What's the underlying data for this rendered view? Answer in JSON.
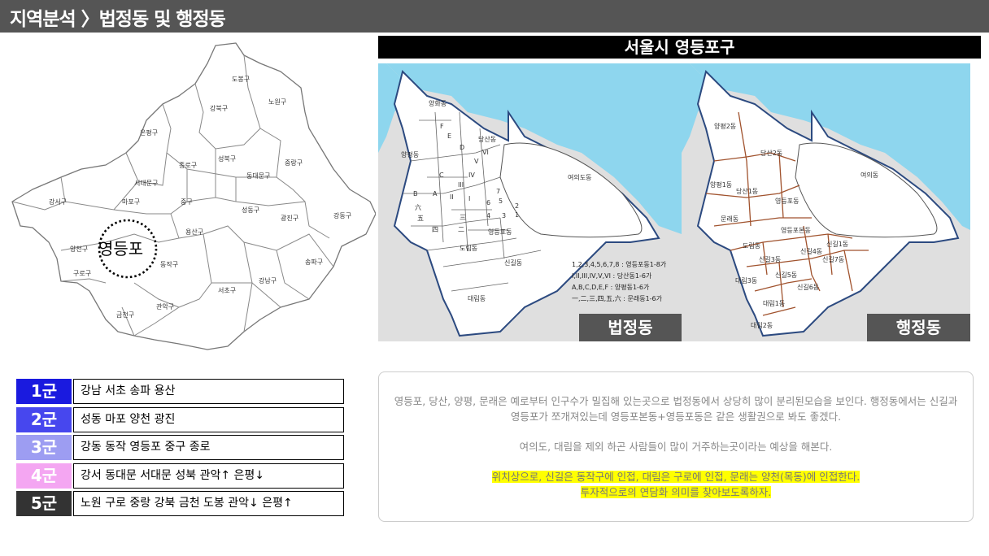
{
  "header": {
    "title": "지역분석 〉법정동 및 행정동"
  },
  "right_title": "서울시 영등포구",
  "seoul_map": {
    "districts": {
      "dobong": "도봉구",
      "nowon": "노원구",
      "gangbuk": "강북구",
      "eunpyeong": "은평구",
      "seongbuk": "성북구",
      "jungnang": "중랑구",
      "jongno": "종로구",
      "seodaemun": "서대문구",
      "dongdaemun": "동대문구",
      "gangseo": "강서구",
      "mapo": "마포구",
      "jung": "중구",
      "seongdong": "성동구",
      "gwangjin": "광진구",
      "gangdong": "강동구",
      "yongsan": "용산구",
      "yangcheon": "양천구",
      "guro": "구로구",
      "dongjak": "동작구",
      "songpa": "송파구",
      "gangnam": "강남구",
      "seocho": "서초구",
      "gwanak": "관악구",
      "geumcheon": "금천구"
    },
    "highlight": "영등포"
  },
  "legal_map": {
    "badge": "법정동",
    "dongs": {
      "yanghwa": "양화동",
      "dangsan": "당산동",
      "yangpyeong": "양평동",
      "yeouido": "여의도동",
      "yeongdeungpo": "영등포동",
      "dorim": "도림동",
      "singil": "신길동",
      "daerim": "대림동"
    },
    "letters": {
      "f": "F",
      "e": "E",
      "d": "D",
      "c": "C",
      "b": "B",
      "a": "A",
      "r6": "VI",
      "r5": "V",
      "r4": "IV",
      "r3": "III",
      "r2": "II",
      "r1": "I",
      "n6": "6",
      "n5": "5",
      "n2": "2",
      "n7": "7",
      "n4": "4",
      "n3": "3",
      "n1": "1",
      "h6": "六",
      "h5": "五",
      "h4": "四",
      "h3": "三",
      "h2": "二"
    },
    "legend": [
      "1,2,3,4,5,6,7,8 : 영등포동1-8가",
      "I,II,III,IV,V,VI : 당산동1-6가",
      "A,B,C,D,E,F : 양평동1-6가",
      "一,二,三,四,五,六 : 문래동1-6가"
    ]
  },
  "admin_map": {
    "badge": "행정동",
    "dongs": {
      "yp2": "양평2동",
      "ds2": "당산2동",
      "yeouido": "여의동",
      "yp1": "양평1동",
      "ds1": "당산1동",
      "ydp": "영등포동",
      "mullae": "문래동",
      "ydpbon": "영등포본동",
      "dorim": "도림동",
      "sg1": "신길1동",
      "sg4": "신길4동",
      "sg3": "신길3동",
      "sg7": "신길7동",
      "dr3": "대림3동",
      "sg5": "신길5동",
      "sg6": "신길6동",
      "dr1": "대림1동",
      "dr2": "대림2동"
    }
  },
  "grades": [
    {
      "label": "1군",
      "color": "#1a1adf",
      "text": "강남 서초 송파 용산"
    },
    {
      "label": "2군",
      "color": "#4747ee",
      "text": "성동 마포 양천 광진"
    },
    {
      "label": "3군",
      "color": "#9d9df2",
      "text": "강동 동작 영등포 중구 종로"
    },
    {
      "label": "4군",
      "color": "#f4a6f2",
      "text": "강서 동대문 서대문 성북 관악↑ 은평↓"
    },
    {
      "label": "5군",
      "color": "#333333",
      "text": "노원 구로 중랑 강북 금천 도봉 관악↓ 은평↑"
    }
  ],
  "notes": {
    "p1": "영등포, 당산, 양평, 문래은 예로부터 인구수가 밀집해 있는곳으로 법정동에서 상당히 많이 분리된모습을 보인다. 행정동에서는 신길과 영등포가 쪼개져있는데 영등포본동+영등포동은 같은 생활권으로 봐도 좋겠다.",
    "p2": "여의도, 대림을 제외 하곤 사람들이 많이 거주하는곳이라는 예상을 해본다.",
    "p3a": "위치상으로, 신길은 동작구에 인접, 대림은 구로에 인접, 문래는 양천(목동)에 인접한다.",
    "p3b": "투자적으로의 연담화 의미를 찾아보도록하자."
  }
}
